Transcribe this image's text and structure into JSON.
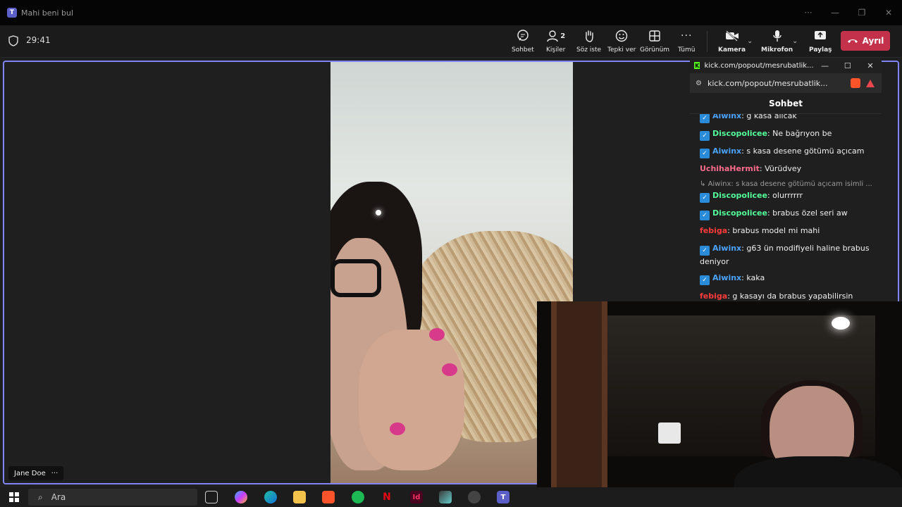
{
  "window": {
    "title": "Mahi beni bul",
    "app_icon": "teams-icon"
  },
  "meeting": {
    "timer": "29:41"
  },
  "toolbar": {
    "chat": "Sohbet",
    "people": "Kişiler",
    "people_count": "2",
    "raise_hand": "Söz iste",
    "react": "Tepki ver",
    "view": "Görünüm",
    "more": "Tümü",
    "camera": "Kamera",
    "mic": "Mikrofon",
    "share": "Paylaş",
    "leave": "Ayrıl"
  },
  "participant": {
    "name": "Jane Doe"
  },
  "popout": {
    "tab_title": "kick.com/popout/mesrubatlik...",
    "url": "kick.com/popout/mesrubatlik...",
    "chat_title": "Sohbet",
    "messages": [
      {
        "user": "Aiwinx",
        "color": "#4aa3ff",
        "badge": true,
        "text": "g kasa alicak"
      },
      {
        "user": "Discopolicee",
        "color": "#53fc9a",
        "badge": true,
        "text": "Ne bağrıyon be"
      },
      {
        "user": "Aiwinx",
        "color": "#4aa3ff",
        "badge": true,
        "text": "s kasa desene götümü açıcam"
      },
      {
        "user": "UchihaHermit",
        "color": "#ff6b8b",
        "badge": false,
        "text": "Vürüdvey"
      },
      {
        "user": "Discopolicee",
        "color": "#53fc9a",
        "badge": true,
        "text": "olurrrrrr"
      },
      {
        "user": "Discopolicee",
        "color": "#53fc9a",
        "badge": true,
        "text": "brabus özel seri aw"
      },
      {
        "user": "febiga",
        "color": "#ff3b3b",
        "badge": false,
        "text": "brabus model mi mahi"
      },
      {
        "user": "Aiwinx",
        "color": "#4aa3ff",
        "badge": true,
        "text": "g63 ün modifiyeli haline brabus deniyor"
      },
      {
        "user": "Aiwinx",
        "color": "#4aa3ff",
        "badge": true,
        "text": "kaka"
      },
      {
        "user": "febiga",
        "color": "#ff3b3b",
        "badge": false,
        "text": "g kasayı da brabus yapabilirsin"
      }
    ],
    "reply_preview": "Aiwinx: s kasa desene götümü açıcam isimli ..."
  },
  "taskbar": {
    "search_placeholder": "Ara"
  },
  "colors": {
    "leave": "#c4314b",
    "accent": "#7f85f5"
  }
}
